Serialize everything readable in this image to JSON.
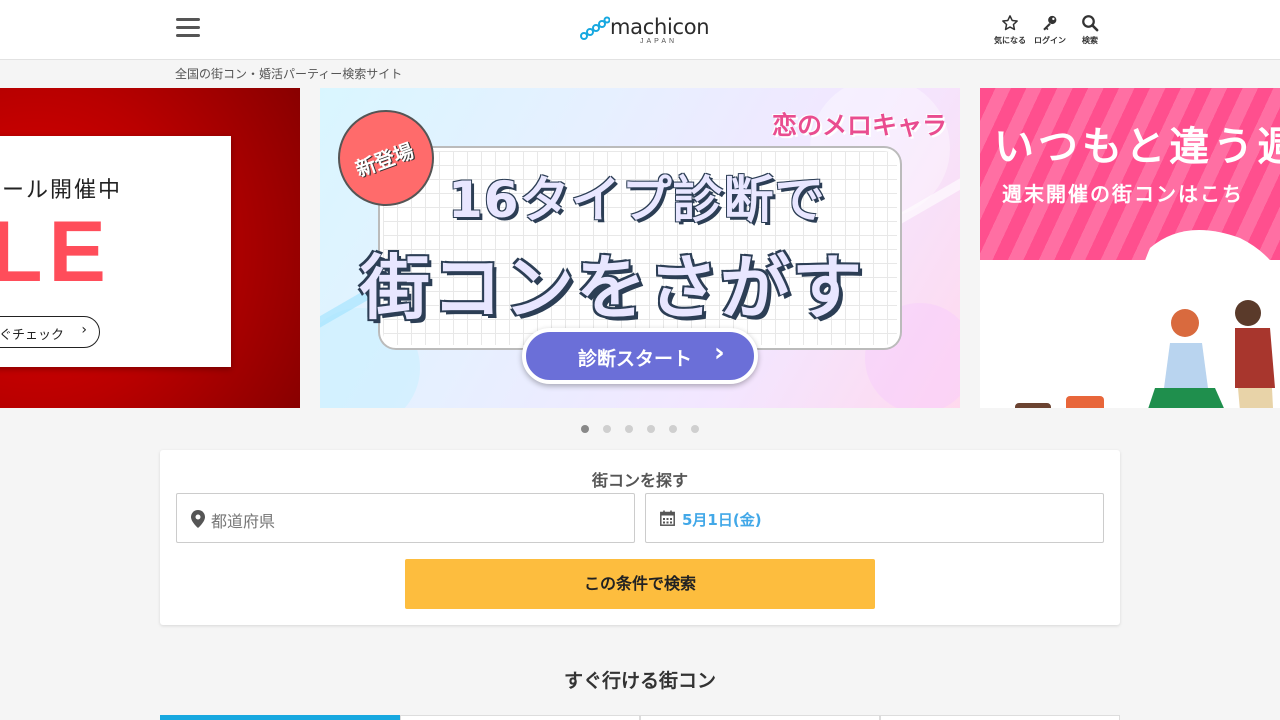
{
  "header": {
    "logo_text": "machicon",
    "logo_sub": "JAPAN",
    "icons": [
      {
        "name": "favorite",
        "icon": "star-icon",
        "label": "気になる"
      },
      {
        "name": "login",
        "icon": "key-icon",
        "label": "ログイン"
      },
      {
        "name": "search",
        "icon": "search-icon",
        "label": "検索"
      }
    ]
  },
  "tagline": "全国の街コン・婚活パーティー検索サイト",
  "carousel": {
    "left_banner": {
      "line1": "ール開催中",
      "line2": "LE",
      "button": "ぐチェック"
    },
    "center_banner": {
      "brand": "恋のメロキャラ",
      "badge": "新登場",
      "headline1": "16タイプ診断で",
      "headline2": "街コンをさがす",
      "button": "診断スタート"
    },
    "right_banner": {
      "line1": "いつもと違う週",
      "line2": "週末開催の街コンはこち"
    },
    "slide_count": 6,
    "active_index": 0
  },
  "search": {
    "title": "街コンを探す",
    "prefecture_placeholder": "都道府県",
    "date_value": "5月1日(金)",
    "submit_label": "この条件で検索"
  },
  "section": {
    "title": "すぐ行ける街コン",
    "tab_count": 4,
    "active_tab": 0
  },
  "colors": {
    "accent_blue": "#17a8e0",
    "search_button": "#fdbd3e",
    "date_text": "#42a8e8",
    "sale_red": "#b90000",
    "pink": "#ff4f8e"
  }
}
